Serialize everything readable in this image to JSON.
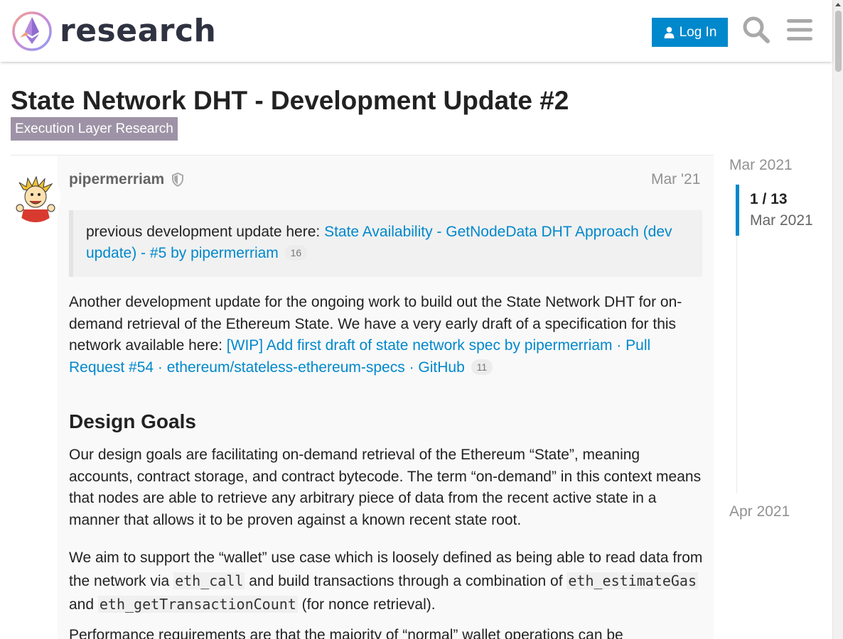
{
  "header": {
    "logo_text": "research",
    "login_label": "Log In",
    "login_icon": "user-icon",
    "search_icon": "search-icon",
    "menu_icon": "hamburger-menu-icon"
  },
  "topic": {
    "title": "State Network DHT - Development Update #2",
    "category": "Execution Layer Research"
  },
  "post": {
    "username": "pipermerriam",
    "moderator_icon": "shield-icon",
    "date": "Mar '21",
    "quote": {
      "text": "previous development update here: ",
      "link": "State Availability - GetNodeData DHT Approach (dev update) - #5 by pipermerriam",
      "clicks": "16"
    },
    "p1": {
      "text": "Another development update for the ongoing work to build out the State Network DHT for on-demand retrieval of the Ethereum State. We have a very early draft of a specification for this network available here: ",
      "link": "[WIP] Add first draft of state network spec by pipermerriam · Pull Request #54 · ethereum/stateless-ethereum-specs · GitHub",
      "clicks": "11"
    },
    "heading": "Design Goals",
    "p2": "Our design goals are facilitating on-demand retrieval of the Ethereum “State”, meaning accounts, contract storage, and contract bytecode. The term “on-demand” in this context means that nodes are able to retrieve any arbitrary piece of data from the recent active state in a manner that allows it to be proven against a known recent state root.",
    "p3": {
      "a": "We aim to support the “wallet” use case which is loosely defined as being able to read data from the network via ",
      "code1": "eth_call",
      "b": " and build transactions through a combination of ",
      "code2": "eth_estimateGas",
      "c": " and ",
      "code3": "eth_getTransactionCount",
      "d": " (for nonce retrieval)."
    },
    "p4": "Performance requirements are that the majority of “normal” wallet operations can be"
  },
  "timeline": {
    "start": "Mar 2021",
    "position": "1 / 13",
    "current_date": "Mar 2021",
    "end": "Apr 2021"
  },
  "colors": {
    "accent": "#0088cc",
    "category": "#9e93a6",
    "logo_dark": "#2f3240"
  }
}
